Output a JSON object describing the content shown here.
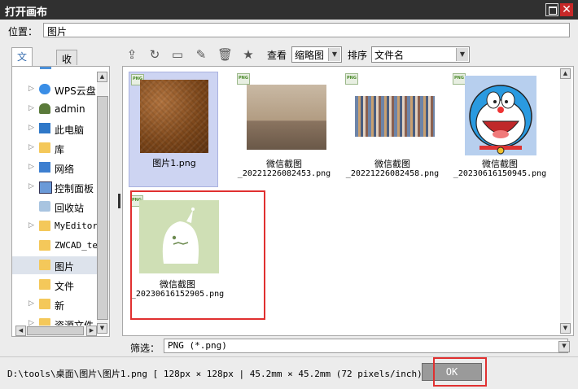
{
  "window": {
    "title": "打开画布"
  },
  "location": {
    "label": "位置：",
    "value": "图片"
  },
  "tabs": [
    {
      "label": "文件夹"
    },
    {
      "label": "收藏夹"
    }
  ],
  "tree": {
    "items": [
      {
        "label": "WPS云盘",
        "icon": "cloud-icon"
      },
      {
        "label": "admin",
        "icon": "user-icon"
      },
      {
        "label": "此电脑",
        "icon": "computer-icon"
      },
      {
        "label": "库",
        "icon": "library-icon"
      },
      {
        "label": "网络",
        "icon": "network-icon"
      },
      {
        "label": "控制面板",
        "icon": "control-panel-icon"
      },
      {
        "label": "回收站",
        "icon": "recycle-bin-icon"
      },
      {
        "label": "MyEditor",
        "icon": "folder-icon"
      },
      {
        "label": "ZWCAD_te",
        "icon": "folder-icon"
      },
      {
        "label": "图片",
        "icon": "folder-icon",
        "selected": true
      },
      {
        "label": "文件",
        "icon": "folder-icon"
      },
      {
        "label": "新",
        "icon": "folder-icon"
      },
      {
        "label": "资源文件",
        "icon": "folder-icon"
      }
    ]
  },
  "toolbar": {
    "view_label": "查看",
    "view_value": "缩略图",
    "sort_label": "排序",
    "sort_value": "文件名",
    "icons": [
      "up-folder-icon",
      "refresh-icon",
      "new-folder-icon",
      "rename-icon",
      "delete-icon",
      "favorite-star-icon"
    ]
  },
  "files": [
    {
      "line1": "图片1.png",
      "line2": "",
      "thumb": "leather",
      "selected": true
    },
    {
      "line1": "微信截图",
      "line2": "_20221226082453.png",
      "thumb": "bridge"
    },
    {
      "line1": "微信截图",
      "line2": "_20221226082458.png",
      "thumb": "crowd"
    },
    {
      "line1": "微信截图",
      "line2": "_20230616150945.png",
      "thumb": "dora"
    },
    {
      "line1": "微信截图",
      "line2": "_20230616152905.png",
      "thumb": "mascot"
    }
  ],
  "badge_text": "PNG",
  "filter": {
    "label": "筛选：",
    "value": "PNG (*.png)"
  },
  "status": {
    "text": "D:\\tools\\桌面\\图片\\图片1.png  [ 128px × 128px  |  45.2mm × 45.2mm (72 pixels/inch)",
    "ok_label": "OK"
  },
  "colors": {
    "highlight_red": "#e03030",
    "selection": "#cdd4f2"
  }
}
